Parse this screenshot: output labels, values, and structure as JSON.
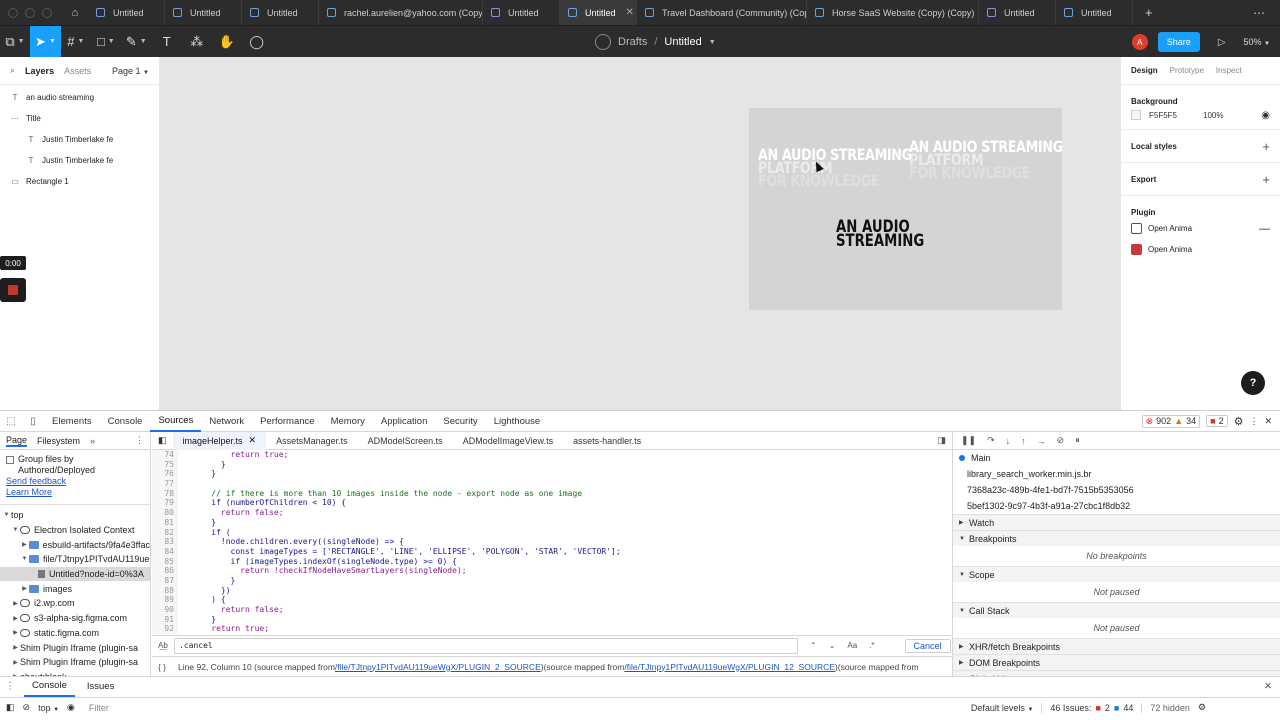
{
  "tabs": [
    {
      "label": "Untitled",
      "active": false
    },
    {
      "label": "Untitled",
      "active": false
    },
    {
      "label": "Untitled",
      "active": false
    },
    {
      "label": "rachel.aurelien@yahoo.com (Copy)",
      "active": false
    },
    {
      "label": "Untitled",
      "active": false
    },
    {
      "label": "Untitled",
      "active": true
    },
    {
      "label": "Travel Dashboard (Community) (Copy)",
      "active": false
    },
    {
      "label": "Horse SaaS Website (Copy) (Copy)",
      "active": false
    },
    {
      "label": "Untitled",
      "active": false
    },
    {
      "label": "Untitled",
      "active": false
    }
  ],
  "toolbar": {
    "drafts": "Drafts",
    "separator": "/",
    "file_name": "Untitled",
    "avatar_letter": "A",
    "share_label": "Share",
    "zoom": "50%"
  },
  "left_panel": {
    "tab_layers": "Layers",
    "tab_assets": "Assets",
    "page": "Page 1",
    "layers": [
      {
        "name": "an audio streaming",
        "type": "text",
        "indent": 0
      },
      {
        "name": "Title",
        "type": "frame",
        "indent": 0
      },
      {
        "name": "Justin Timberlake fe",
        "type": "text",
        "indent": 1
      },
      {
        "name": "Justin Timberlake fe",
        "type": "text",
        "indent": 1
      },
      {
        "name": "Rectangle 1",
        "type": "rect",
        "indent": 0
      }
    ]
  },
  "canvas": {
    "ghost_left": [
      "AN AUDIO STREAMING",
      "PLATFORM",
      "FOR KNOWLEDGE"
    ],
    "ghost_right": [
      "AN AUDIO STREAMING",
      "PLATFORM",
      "FOR KNOWLEDGE"
    ],
    "title_lines": [
      "AN AUDIO",
      "STREAMING"
    ],
    "timer": "0:00"
  },
  "right_panel": {
    "tab_design": "Design",
    "tab_prototype": "Prototype",
    "tab_inspect": "Inspect",
    "background_title": "Background",
    "background_hex": "F5F5F5",
    "background_opacity": "100%",
    "local_styles": "Local styles",
    "export": "Export",
    "plugin_title": "Plugin",
    "plugins": [
      "Open Anima",
      "Open Anima"
    ],
    "help": "?"
  },
  "devtools": {
    "tabs": [
      "Elements",
      "Console",
      "Sources",
      "Network",
      "Performance",
      "Memory",
      "Application",
      "Security",
      "Lighthouse"
    ],
    "active_tab": "Sources",
    "errors": "902",
    "warnings": "34",
    "issues_badge": "2",
    "nav_tabs": [
      "Page",
      "Filesystem"
    ],
    "group_label": "Group files by Authored/Deployed",
    "send_feedback": "Send feedback",
    "learn_more": "Learn More",
    "tree": [
      {
        "label": "top",
        "icon": "frame",
        "depth": 0,
        "arrow": "▼"
      },
      {
        "label": "Electron Isolated Context",
        "icon": "cloud",
        "depth": 1,
        "arrow": "▼"
      },
      {
        "label": "esbuild-artifacts/9fa4e3ffac",
        "icon": "folder",
        "depth": 2,
        "arrow": "▶"
      },
      {
        "label": "file/TJtnpy1PITvdAU119ue",
        "icon": "folder",
        "depth": 2,
        "arrow": "▼"
      },
      {
        "label": "Untitled?node-id=0%3A",
        "icon": "file",
        "depth": 3,
        "arrow": "",
        "selected": true
      },
      {
        "label": "images",
        "icon": "folder",
        "depth": 2,
        "arrow": "▶"
      },
      {
        "label": "i2.wp.com",
        "icon": "cloud",
        "depth": 1,
        "arrow": "▶"
      },
      {
        "label": "s3-alpha-sig.figma.com",
        "icon": "cloud",
        "depth": 1,
        "arrow": "▶"
      },
      {
        "label": "static.figma.com",
        "icon": "cloud",
        "depth": 1,
        "arrow": "▶"
      },
      {
        "label": "Shim Plugin Iframe (plugin-sa",
        "icon": "frame",
        "depth": 1,
        "arrow": "▶"
      },
      {
        "label": "Shim Plugin Iframe (plugin-sa",
        "icon": "frame",
        "depth": 1,
        "arrow": "▶"
      },
      {
        "label": "about:blank",
        "icon": "frame",
        "depth": 1,
        "arrow": "▶"
      }
    ],
    "editor_tabs": [
      "imageHelper.ts",
      "AssetsManager.ts",
      "ADModelScreen.ts",
      "ADModelImageView.ts",
      "assets-handler.ts"
    ],
    "code": [
      {
        "n": "74",
        "t": "        return true;",
        "c": "kw"
      },
      {
        "n": "75",
        "t": "      }",
        "c": ""
      },
      {
        "n": "76",
        "t": "    }",
        "c": ""
      },
      {
        "n": "77",
        "t": "",
        "c": ""
      },
      {
        "n": "78",
        "t": "    // if there is more than 10 images inside the node - export node as one image",
        "c": "cm"
      },
      {
        "n": "79",
        "t": "    if (numberOfChildren < 10) {",
        "c": ""
      },
      {
        "n": "80",
        "t": "      return false;",
        "c": "kw"
      },
      {
        "n": "81",
        "t": "    }",
        "c": ""
      },
      {
        "n": "82",
        "t": "    if (",
        "c": ""
      },
      {
        "n": "83",
        "t": "      !node.children.every((singleNode) => {",
        "c": ""
      },
      {
        "n": "84",
        "t": "        const imageTypes = ['RECTANGLE', 'LINE', 'ELLIPSE', 'POLYGON', 'STAR', 'VECTOR'];",
        "c": ""
      },
      {
        "n": "85",
        "t": "        if (imageTypes.indexOf(singleNode.type) >= 0) {",
        "c": ""
      },
      {
        "n": "86",
        "t": "          return !checkIfNodeHaveSmartLayers(singleNode);",
        "c": "kw"
      },
      {
        "n": "87",
        "t": "        }",
        "c": ""
      },
      {
        "n": "88",
        "t": "      })",
        "c": ""
      },
      {
        "n": "89",
        "t": "    ) {",
        "c": ""
      },
      {
        "n": "90",
        "t": "      return false;",
        "c": "kw"
      },
      {
        "n": "91",
        "t": "    }",
        "c": ""
      },
      {
        "n": "92",
        "t": "    return true;",
        "c": "kw"
      }
    ],
    "search_value": ".cancel",
    "match_case": "Aa",
    "regex": ".*",
    "cancel": "Cancel",
    "status_prefix": "Line 92, Column 10  (source mapped from ",
    "status_link1": "/file/TJtnpy1PITvdAU119ueWgX/PLUGIN_2_SOURCE",
    "status_mid": ")(source mapped from ",
    "status_link2": "/file/TJtnpy1PITvdAU119ueWgX/PLUGIN_12_SOURCE",
    "status_suffix": ")(source mapped from",
    "threads": [
      "Main",
      "library_search_worker.min.js.br",
      "7368a23c-489b-4fe1-bd7f-7515b5353056",
      "5bef1302-9c97-4b3f-a91a-27cbc1f8db32"
    ],
    "sections": [
      {
        "title": "Watch",
        "open": false,
        "body": ""
      },
      {
        "title": "Breakpoints",
        "open": true,
        "body": "No breakpoints"
      },
      {
        "title": "Scope",
        "open": true,
        "body": "Not paused"
      },
      {
        "title": "Call Stack",
        "open": true,
        "body": "Not paused"
      },
      {
        "title": "XHR/fetch Breakpoints",
        "open": false,
        "body": ""
      },
      {
        "title": "DOM Breakpoints",
        "open": false,
        "body": ""
      },
      {
        "title": "Global Listeners",
        "open": false,
        "body": ""
      }
    ],
    "drawer_tabs": [
      "Console",
      "Issues"
    ],
    "context": "top",
    "filter_placeholder": "Filter",
    "levels": "Default levels",
    "issues_label": "46 Issues:",
    "issues_err": "2",
    "issues_info": "44",
    "hidden": "72 hidden"
  }
}
